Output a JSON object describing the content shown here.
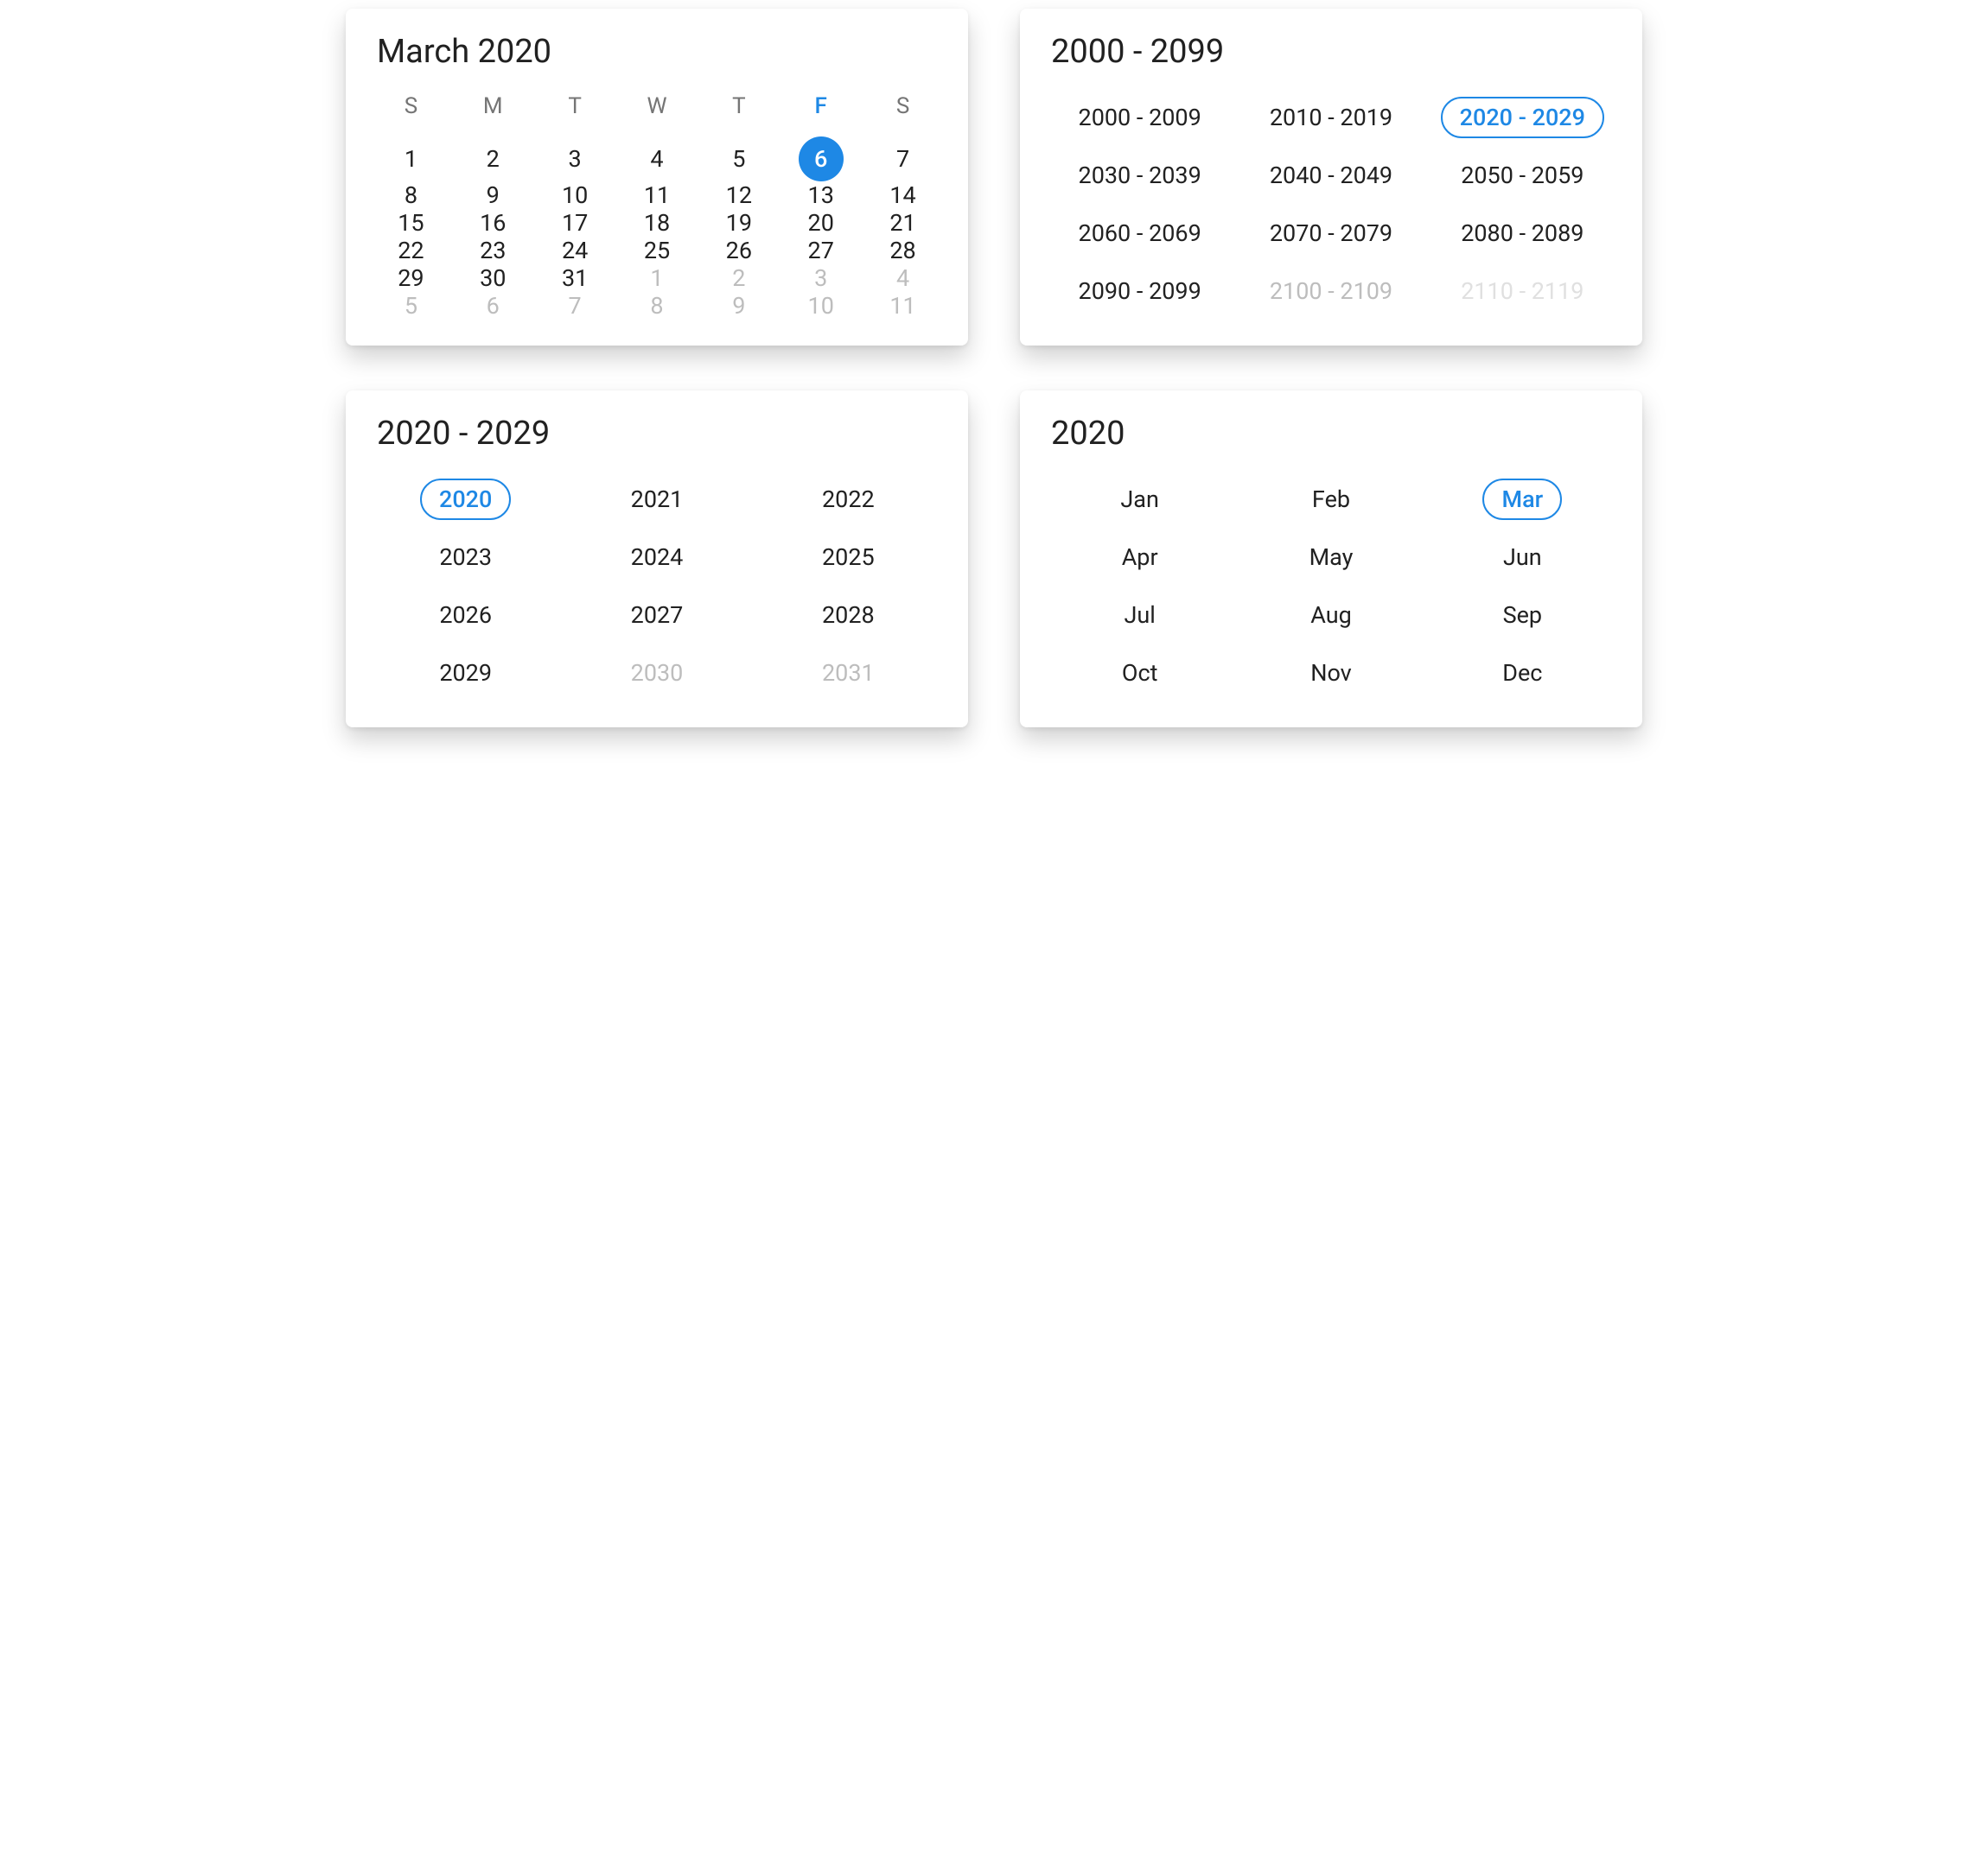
{
  "colors": {
    "accent": "#1e88e5",
    "muted": "#bdbdbd",
    "ghost": "#e0e0e0",
    "text": "#212121"
  },
  "day_view": {
    "title": "March 2020",
    "weekdays": [
      "S",
      "M",
      "T",
      "W",
      "T",
      "F",
      "S"
    ],
    "selected_weekday_index": 5,
    "rows": [
      [
        {
          "n": 1
        },
        {
          "n": 2
        },
        {
          "n": 3
        },
        {
          "n": 4
        },
        {
          "n": 5
        },
        {
          "n": 6,
          "selected": true
        },
        {
          "n": 7
        }
      ],
      [
        {
          "n": 8
        },
        {
          "n": 9
        },
        {
          "n": 10
        },
        {
          "n": 11
        },
        {
          "n": 12
        },
        {
          "n": 13
        },
        {
          "n": 14
        }
      ],
      [
        {
          "n": 15
        },
        {
          "n": 16
        },
        {
          "n": 17
        },
        {
          "n": 18
        },
        {
          "n": 19
        },
        {
          "n": 20
        },
        {
          "n": 21
        }
      ],
      [
        {
          "n": 22
        },
        {
          "n": 23
        },
        {
          "n": 24
        },
        {
          "n": 25
        },
        {
          "n": 26
        },
        {
          "n": 27
        },
        {
          "n": 28
        }
      ],
      [
        {
          "n": 29
        },
        {
          "n": 30
        },
        {
          "n": 31
        },
        {
          "n": 1,
          "overflow": true
        },
        {
          "n": 2,
          "overflow": true
        },
        {
          "n": 3,
          "overflow": true
        },
        {
          "n": 4,
          "overflow": true
        }
      ],
      [
        {
          "n": 5,
          "overflow": true
        },
        {
          "n": 6,
          "overflow": true
        },
        {
          "n": 7,
          "overflow": true
        },
        {
          "n": 8,
          "overflow": true
        },
        {
          "n": 9,
          "overflow": true
        },
        {
          "n": 10,
          "overflow": true
        },
        {
          "n": 11,
          "overflow": true
        }
      ]
    ]
  },
  "century_view": {
    "title": "2000 - 2099",
    "cells": [
      {
        "label": "2000 - 2009"
      },
      {
        "label": "2010 - 2019"
      },
      {
        "label": "2020 - 2029",
        "selected": true
      },
      {
        "label": "2030 - 2039"
      },
      {
        "label": "2040 - 2049"
      },
      {
        "label": "2050 - 2059"
      },
      {
        "label": "2060 - 2069"
      },
      {
        "label": "2070 - 2079"
      },
      {
        "label": "2080 - 2089"
      },
      {
        "label": "2090 - 2099"
      },
      {
        "label": "2100 - 2109",
        "dim": true
      },
      {
        "label": "2110 - 2119",
        "ghost": true
      }
    ]
  },
  "decade_view": {
    "title": "2020 - 2029",
    "cells": [
      {
        "label": "2020",
        "selected": true
      },
      {
        "label": "2021"
      },
      {
        "label": "2022"
      },
      {
        "label": "2023"
      },
      {
        "label": "2024"
      },
      {
        "label": "2025"
      },
      {
        "label": "2026"
      },
      {
        "label": "2027"
      },
      {
        "label": "2028"
      },
      {
        "label": "2029"
      },
      {
        "label": "2030",
        "dim": true
      },
      {
        "label": "2031",
        "dim": true
      }
    ]
  },
  "month_view": {
    "title": "2020",
    "cells": [
      {
        "label": "Jan"
      },
      {
        "label": "Feb"
      },
      {
        "label": "Mar",
        "selected": true
      },
      {
        "label": "Apr"
      },
      {
        "label": "May"
      },
      {
        "label": "Jun"
      },
      {
        "label": "Jul"
      },
      {
        "label": "Aug"
      },
      {
        "label": "Sep"
      },
      {
        "label": "Oct"
      },
      {
        "label": "Nov"
      },
      {
        "label": "Dec"
      }
    ]
  }
}
